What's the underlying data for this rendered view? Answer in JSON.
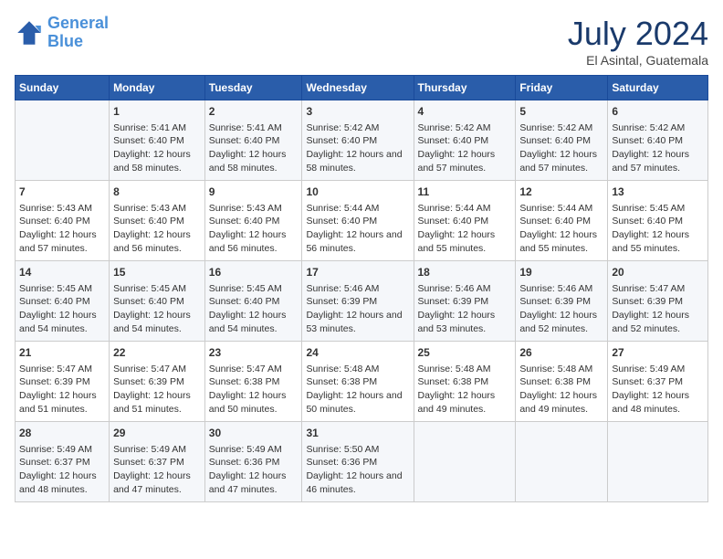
{
  "header": {
    "logo_line1": "General",
    "logo_line2": "Blue",
    "month": "July 2024",
    "location": "El Asintal, Guatemala"
  },
  "days_of_week": [
    "Sunday",
    "Monday",
    "Tuesday",
    "Wednesday",
    "Thursday",
    "Friday",
    "Saturday"
  ],
  "weeks": [
    [
      {
        "day": "",
        "info": ""
      },
      {
        "day": "1",
        "info": "Sunrise: 5:41 AM\nSunset: 6:40 PM\nDaylight: 12 hours\nand 58 minutes."
      },
      {
        "day": "2",
        "info": "Sunrise: 5:41 AM\nSunset: 6:40 PM\nDaylight: 12 hours\nand 58 minutes."
      },
      {
        "day": "3",
        "info": "Sunrise: 5:42 AM\nSunset: 6:40 PM\nDaylight: 12 hours\nand 58 minutes."
      },
      {
        "day": "4",
        "info": "Sunrise: 5:42 AM\nSunset: 6:40 PM\nDaylight: 12 hours\nand 57 minutes."
      },
      {
        "day": "5",
        "info": "Sunrise: 5:42 AM\nSunset: 6:40 PM\nDaylight: 12 hours\nand 57 minutes."
      },
      {
        "day": "6",
        "info": "Sunrise: 5:42 AM\nSunset: 6:40 PM\nDaylight: 12 hours\nand 57 minutes."
      }
    ],
    [
      {
        "day": "7",
        "info": "Sunrise: 5:43 AM\nSunset: 6:40 PM\nDaylight: 12 hours\nand 57 minutes."
      },
      {
        "day": "8",
        "info": "Sunrise: 5:43 AM\nSunset: 6:40 PM\nDaylight: 12 hours\nand 56 minutes."
      },
      {
        "day": "9",
        "info": "Sunrise: 5:43 AM\nSunset: 6:40 PM\nDaylight: 12 hours\nand 56 minutes."
      },
      {
        "day": "10",
        "info": "Sunrise: 5:44 AM\nSunset: 6:40 PM\nDaylight: 12 hours\nand 56 minutes."
      },
      {
        "day": "11",
        "info": "Sunrise: 5:44 AM\nSunset: 6:40 PM\nDaylight: 12 hours\nand 55 minutes."
      },
      {
        "day": "12",
        "info": "Sunrise: 5:44 AM\nSunset: 6:40 PM\nDaylight: 12 hours\nand 55 minutes."
      },
      {
        "day": "13",
        "info": "Sunrise: 5:45 AM\nSunset: 6:40 PM\nDaylight: 12 hours\nand 55 minutes."
      }
    ],
    [
      {
        "day": "14",
        "info": "Sunrise: 5:45 AM\nSunset: 6:40 PM\nDaylight: 12 hours\nand 54 minutes."
      },
      {
        "day": "15",
        "info": "Sunrise: 5:45 AM\nSunset: 6:40 PM\nDaylight: 12 hours\nand 54 minutes."
      },
      {
        "day": "16",
        "info": "Sunrise: 5:45 AM\nSunset: 6:40 PM\nDaylight: 12 hours\nand 54 minutes."
      },
      {
        "day": "17",
        "info": "Sunrise: 5:46 AM\nSunset: 6:39 PM\nDaylight: 12 hours\nand 53 minutes."
      },
      {
        "day": "18",
        "info": "Sunrise: 5:46 AM\nSunset: 6:39 PM\nDaylight: 12 hours\nand 53 minutes."
      },
      {
        "day": "19",
        "info": "Sunrise: 5:46 AM\nSunset: 6:39 PM\nDaylight: 12 hours\nand 52 minutes."
      },
      {
        "day": "20",
        "info": "Sunrise: 5:47 AM\nSunset: 6:39 PM\nDaylight: 12 hours\nand 52 minutes."
      }
    ],
    [
      {
        "day": "21",
        "info": "Sunrise: 5:47 AM\nSunset: 6:39 PM\nDaylight: 12 hours\nand 51 minutes."
      },
      {
        "day": "22",
        "info": "Sunrise: 5:47 AM\nSunset: 6:39 PM\nDaylight: 12 hours\nand 51 minutes."
      },
      {
        "day": "23",
        "info": "Sunrise: 5:47 AM\nSunset: 6:38 PM\nDaylight: 12 hours\nand 50 minutes."
      },
      {
        "day": "24",
        "info": "Sunrise: 5:48 AM\nSunset: 6:38 PM\nDaylight: 12 hours\nand 50 minutes."
      },
      {
        "day": "25",
        "info": "Sunrise: 5:48 AM\nSunset: 6:38 PM\nDaylight: 12 hours\nand 49 minutes."
      },
      {
        "day": "26",
        "info": "Sunrise: 5:48 AM\nSunset: 6:38 PM\nDaylight: 12 hours\nand 49 minutes."
      },
      {
        "day": "27",
        "info": "Sunrise: 5:49 AM\nSunset: 6:37 PM\nDaylight: 12 hours\nand 48 minutes."
      }
    ],
    [
      {
        "day": "28",
        "info": "Sunrise: 5:49 AM\nSunset: 6:37 PM\nDaylight: 12 hours\nand 48 minutes."
      },
      {
        "day": "29",
        "info": "Sunrise: 5:49 AM\nSunset: 6:37 PM\nDaylight: 12 hours\nand 47 minutes."
      },
      {
        "day": "30",
        "info": "Sunrise: 5:49 AM\nSunset: 6:36 PM\nDaylight: 12 hours\nand 47 minutes."
      },
      {
        "day": "31",
        "info": "Sunrise: 5:50 AM\nSunset: 6:36 PM\nDaylight: 12 hours\nand 46 minutes."
      },
      {
        "day": "",
        "info": ""
      },
      {
        "day": "",
        "info": ""
      },
      {
        "day": "",
        "info": ""
      }
    ]
  ]
}
